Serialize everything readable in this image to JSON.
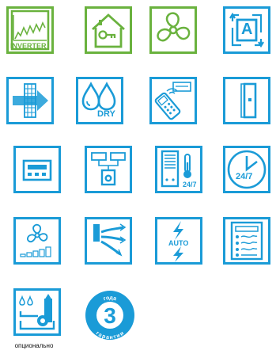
{
  "colors": {
    "green": "#6ab23e",
    "blue": "#1a9bd7"
  },
  "icons": [
    {
      "name": "inverter-icon",
      "label": "INVERTER"
    },
    {
      "name": "home-key-icon"
    },
    {
      "name": "fan-icon"
    },
    {
      "name": "auto-mode-icon",
      "label": "A"
    },
    {
      "name": "air-filter-icon"
    },
    {
      "name": "dry-mode-icon",
      "label": "DRY"
    },
    {
      "name": "remote-control-icon"
    },
    {
      "name": "wall-unit-icon"
    },
    {
      "name": "wired-controller-icon"
    },
    {
      "name": "central-control-icon"
    },
    {
      "name": "thermostat-247-icon",
      "label": "24/7"
    },
    {
      "name": "timer-247-icon",
      "label": "24/7"
    },
    {
      "name": "fan-speed-icon"
    },
    {
      "name": "airflow-swing-icon"
    },
    {
      "name": "auto-power-icon",
      "label": "AUTO"
    },
    {
      "name": "settings-panel-icon"
    },
    {
      "name": "drain-pump-icon"
    }
  ],
  "badge": {
    "number": "3",
    "top_text": "года",
    "bottom_text": "гарантии"
  },
  "caption": "опционально"
}
